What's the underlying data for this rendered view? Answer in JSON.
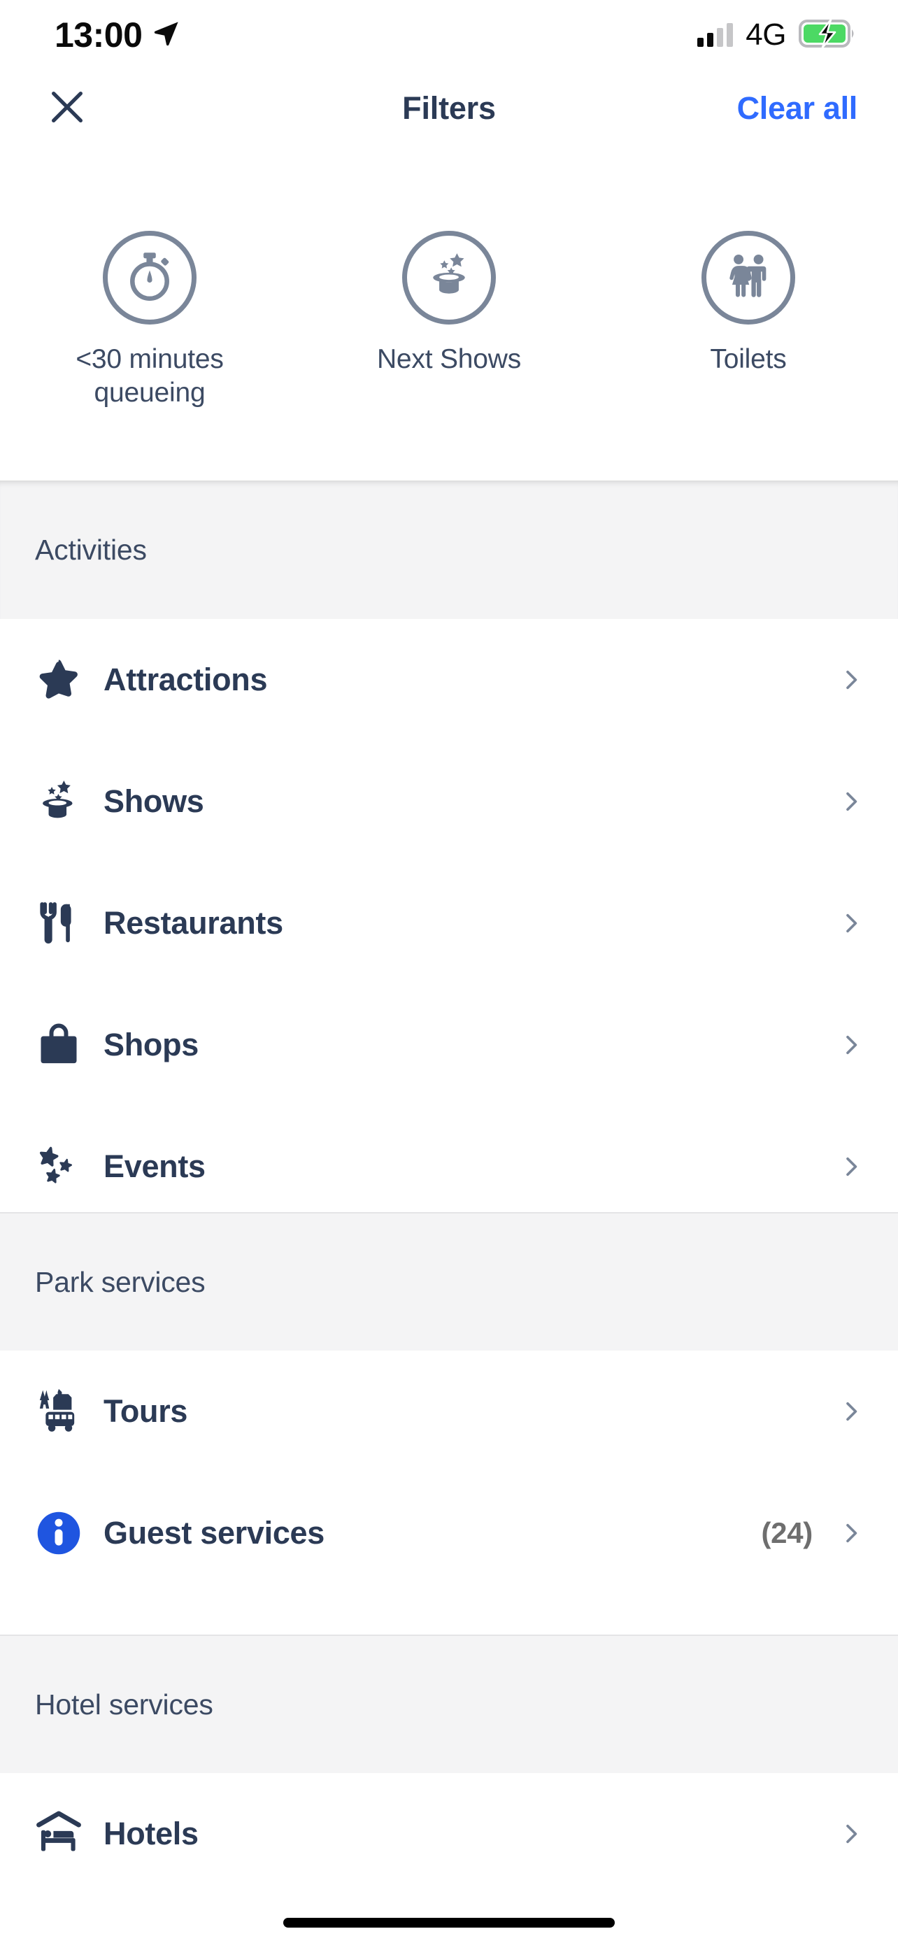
{
  "status_bar": {
    "time": "13:00",
    "location_icon": "location-arrow-icon",
    "signal_icon": "cellular-signal-icon",
    "network": "4G",
    "battery_icon": "battery-charging-icon",
    "signal_bars_filled": 2,
    "signal_bars_total": 4
  },
  "header": {
    "close_icon": "close-icon",
    "title": "Filters",
    "clear_all_label": "Clear all",
    "clear_all_color": "#2f6bff"
  },
  "quick_filters": [
    {
      "label": "<30 minutes queueing",
      "icon": "stopwatch-icon"
    },
    {
      "label": "Next Shows",
      "icon": "magic-hat-icon"
    },
    {
      "label": "Toilets",
      "icon": "toilets-icon"
    }
  ],
  "sections": [
    {
      "title": "Activities",
      "items": [
        {
          "label": "Attractions",
          "icon": "star-icon",
          "count": ""
        },
        {
          "label": "Shows",
          "icon": "magic-hat-icon",
          "count": ""
        },
        {
          "label": "Restaurants",
          "icon": "cutlery-icon",
          "count": ""
        },
        {
          "label": "Shops",
          "icon": "shopping-bag-icon",
          "count": ""
        },
        {
          "label": "Events",
          "icon": "sparkles-icon",
          "count": ""
        }
      ]
    },
    {
      "title": "Park services",
      "items": [
        {
          "label": "Tours",
          "icon": "tour-bus-icon",
          "count": ""
        },
        {
          "label": "Guest services",
          "icon": "info-icon",
          "count": "(24)"
        }
      ]
    },
    {
      "title": "Hotel services",
      "items": [
        {
          "label": "Hotels",
          "icon": "hotel-bed-icon",
          "count": ""
        }
      ]
    }
  ],
  "colors": {
    "text_dark": "#2b3a55",
    "text_muted": "#3c4a63",
    "accent_blue": "#2f6bff",
    "icon_gray": "#7a8699",
    "chevron": "#7a8699",
    "section_bg": "#f4f4f5",
    "count_gray": "#6e6e6e",
    "battery_green": "#4cd964"
  },
  "home_indicator": "home-indicator"
}
